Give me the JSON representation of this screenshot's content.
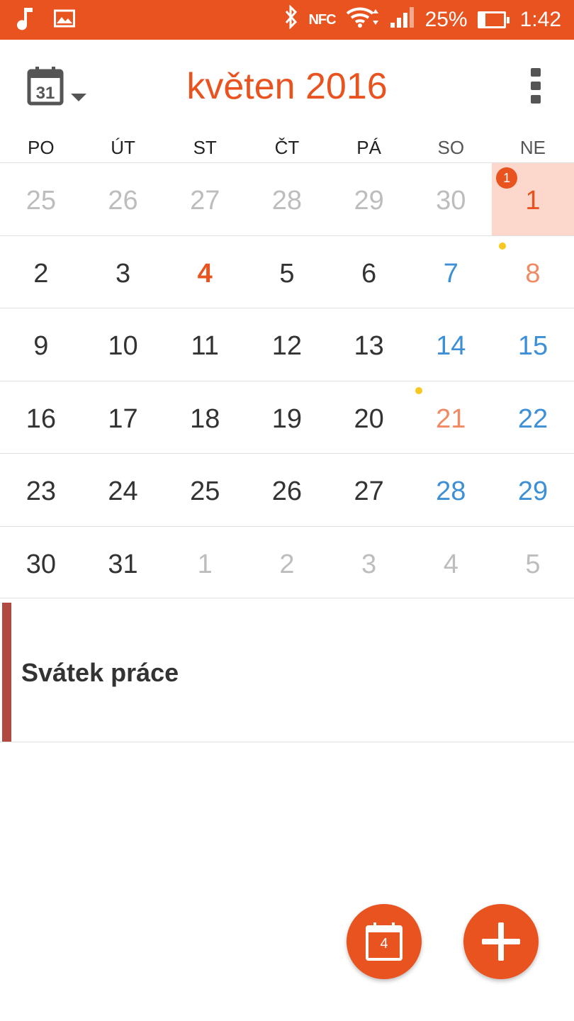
{
  "status_bar": {
    "battery_percent": "25%",
    "battery_level": 0.25,
    "time": "1:42",
    "nfc_label": "NFC",
    "icons": [
      "music-note-icon",
      "image-icon",
      "bluetooth-icon",
      "nfc-icon",
      "wifi-icon",
      "signal-icon",
      "battery-icon"
    ]
  },
  "header": {
    "calendar_icon_number": "31",
    "title": "květen 2016"
  },
  "weekdays": [
    "PO",
    "ÚT",
    "ST",
    "ČT",
    "PÁ",
    "SO",
    "NE"
  ],
  "weeks": [
    [
      "25",
      "26",
      "27",
      "28",
      "29",
      "30",
      "1"
    ],
    [
      "2",
      "3",
      "4",
      "5",
      "6",
      "7",
      "8"
    ],
    [
      "9",
      "10",
      "11",
      "12",
      "13",
      "14",
      "15"
    ],
    [
      "16",
      "17",
      "18",
      "19",
      "20",
      "21",
      "22"
    ],
    [
      "23",
      "24",
      "25",
      "26",
      "27",
      "28",
      "29"
    ],
    [
      "30",
      "31",
      "1",
      "2",
      "3",
      "4",
      "5"
    ]
  ],
  "selected_badge": "1",
  "event": {
    "title": "Svátek práce",
    "color": "#b04a40"
  },
  "fab_today_number": "4",
  "colors": {
    "accent": "#e8531f",
    "weekend_blue": "#3d8fd6",
    "holiday_salmon": "#f08a63",
    "selected_bg": "#fcd8cc",
    "event_dot": "#f7c81e"
  }
}
